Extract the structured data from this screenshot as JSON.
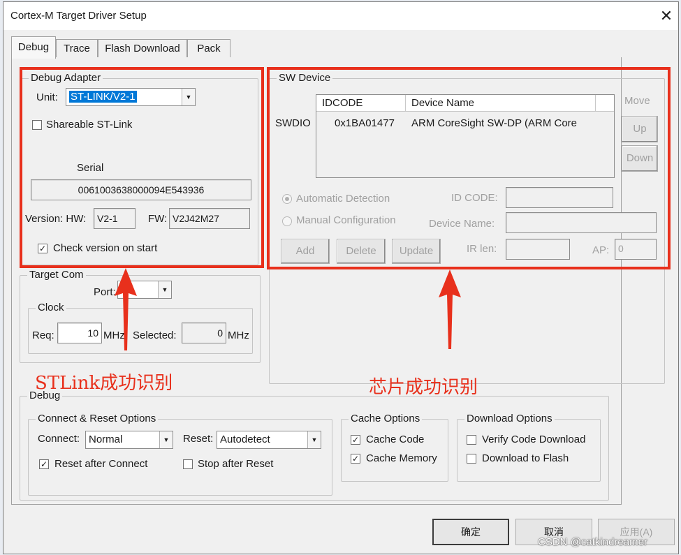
{
  "window": {
    "title": "Cortex-M Target Driver Setup"
  },
  "tabs": [
    "Debug",
    "Trace",
    "Flash Download",
    "Pack"
  ],
  "debug_adapter": {
    "title": "Debug Adapter",
    "unit_label": "Unit:",
    "unit_value": "ST-LINK/V2-1",
    "shareable_label": "Shareable ST-Link",
    "shareable_checked": false,
    "serial_label": "Serial",
    "serial_value": "0061003638000094E543936",
    "version_label": "Version: HW:",
    "hw_value": "V2-1",
    "fw_label": "FW:",
    "fw_value": "V2J42M27",
    "check_version_label": "Check version on start",
    "check_version_checked": true
  },
  "target_com": {
    "title": "Target Com",
    "port_label": "Port:",
    "port_value": "W",
    "clock_title": "Clock",
    "req_label": "Req:",
    "req_value": "10",
    "req_unit": "MHz",
    "selected_label": "Selected:",
    "selected_value": "0",
    "selected_unit": "MHz"
  },
  "sw_device": {
    "title": "SW Device",
    "move_label": "Move",
    "up_button": "Up",
    "down_button": "Down",
    "columns": [
      "IDCODE",
      "Device Name"
    ],
    "row_label": "SWDIO",
    "rows": [
      {
        "idcode": "0x1BA01477",
        "device_name": "ARM CoreSight SW-DP (ARM Core"
      }
    ],
    "auto_detect_label": "Automatic Detection",
    "manual_config_label": "Manual Configuration",
    "id_code_label": "ID CODE:",
    "device_name_label": "Device Name:",
    "add_button": "Add",
    "delete_button": "Delete",
    "update_button": "Update",
    "ir_len_label": "IR len:",
    "ap_label": "AP:",
    "ap_value": "0"
  },
  "debug_section": {
    "title": "Debug",
    "connect_reset": {
      "title": "Connect & Reset Options",
      "connect_label": "Connect:",
      "connect_value": "Normal",
      "reset_label": "Reset:",
      "reset_value": "Autodetect",
      "reset_after_connect_label": "Reset after Connect",
      "reset_after_connect_checked": true,
      "stop_after_reset_label": "Stop after Reset",
      "stop_after_reset_checked": false
    },
    "cache_options": {
      "title": "Cache Options",
      "cache_code_label": "Cache Code",
      "cache_code_checked": true,
      "cache_memory_label": "Cache Memory",
      "cache_memory_checked": true
    },
    "download_options": {
      "title": "Download Options",
      "verify_label": "Verify Code Download",
      "verify_checked": false,
      "download_flash_label": "Download to Flash",
      "download_flash_checked": false
    }
  },
  "footer": {
    "ok_button": "确定",
    "cancel_button": "取消",
    "apply_button": "应用(A)"
  },
  "annotations": {
    "left_note": "STLink成功识别",
    "right_note": "芯片成功识别",
    "accent_color": "#e8301c"
  },
  "watermark": "CSDN @catkindreamer"
}
